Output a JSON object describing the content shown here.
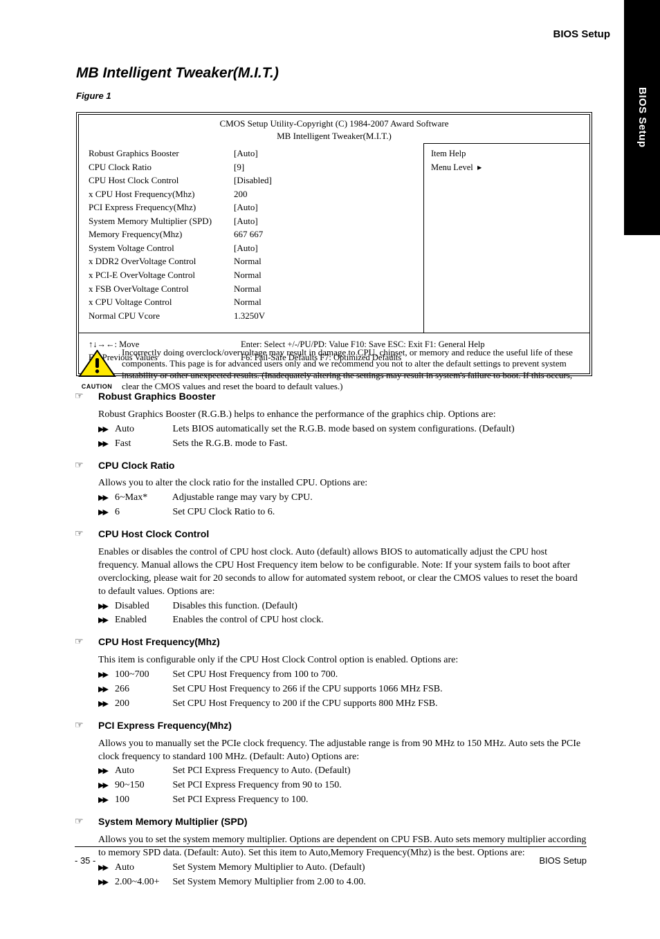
{
  "sideTab": "BIOS Setup",
  "breadcrumb": "BIOS Setup",
  "sectionTitle": "MB Intelligent Tweaker(M.I.T.)",
  "figCaption": "Figure 1",
  "bios": {
    "title": "CMOS Setup Utility-Copyright (C) 1984-2007 Award Software",
    "subtitle": "MB Intelligent Tweaker(M.I.T.)",
    "rows": [
      {
        "label": "Robust Graphics Booster",
        "value": "[Auto]"
      },
      {
        "label": "CPU Clock Ratio",
        "value": "[9]"
      },
      {
        "label": "CPU Host Clock Control",
        "value": "[Disabled]"
      },
      {
        "label": "x CPU Host Frequency(Mhz)",
        "value": "200"
      },
      {
        "label": "PCI Express Frequency(Mhz)",
        "value": "[Auto]"
      },
      {
        "label": "System Memory Multiplier (SPD)",
        "value": "[Auto]"
      },
      {
        "label": "Memory Frequency(Mhz)",
        "value": "667   667"
      },
      {
        "label": "System Voltage Control",
        "value": "[Auto]"
      },
      {
        "label": "x DDR2 OverVoltage Control",
        "value": "Normal"
      },
      {
        "label": "x PCI-E OverVoltage Control",
        "value": "Normal"
      },
      {
        "label": "x FSB OverVoltage Control",
        "value": "Normal"
      },
      {
        "label": "x CPU Voltage Control",
        "value": "Normal"
      },
      {
        "label": "Normal CPU Vcore",
        "value": "1.3250V"
      }
    ],
    "help": {
      "head": "Item Help",
      "menuLevel": "Menu Level"
    },
    "footer": [
      {
        "left": "↑↓→←: Move",
        "right": "Enter: Select   +/-/PU/PD: Value   F10: Save   ESC: Exit   F1: General Help"
      },
      {
        "left": "F5: Previous Values",
        "right": "F6: Fail-Safe Defaults   F7: Optimized Defaults"
      }
    ]
  },
  "caution": "Incorrectly doing overclock/overvoltage may result in damage to CPU, chipset, or memory and reduce the useful life of these components. This page is for advanced users only and we recommend you not to alter the default settings to prevent system instability or other unexpected results. (Inadequately altering the settings may result in system's failure to boot. If this occurs, clear the CMOS values and reset the board to default values.)",
  "items": [
    {
      "name": "Robust Graphics Booster",
      "desc": "Robust Graphics Booster (R.G.B.) helps to enhance the performance of the graphics chip. Options are:",
      "opts": [
        {
          "label": "Auto",
          "text": "Lets BIOS automatically set the R.G.B. mode based on system configurations. (Default)"
        },
        {
          "label": "Fast",
          "text": "Sets the R.G.B. mode to Fast."
        }
      ]
    },
    {
      "name": "CPU Clock Ratio",
      "desc": "Allows you to alter the clock ratio for the installed CPU. Options are:",
      "opts": [
        {
          "label": "6~Max*",
          "text": "Adjustable range may vary by CPU."
        },
        {
          "label": "6",
          "text": "Set CPU Clock Ratio to 6."
        }
      ]
    },
    {
      "name": "CPU Host Clock Control",
      "desc": "Enables or disables the control of CPU host clock. Auto (default) allows BIOS to automatically adjust the CPU host frequency. Manual allows the CPU Host Frequency item below to be configurable. Note: If your system fails to boot after overclocking, please wait for 20 seconds to allow for automated system reboot, or clear the CMOS values to reset the board to default values. Options are:",
      "opts": [
        {
          "label": "Disabled",
          "text": "Disables this function.  (Default)"
        },
        {
          "label": "Enabled",
          "text": "Enables the control of CPU host clock."
        }
      ]
    },
    {
      "name": "CPU Host Frequency(Mhz)",
      "desc": "This item is configurable only if the CPU Host Clock Control option is enabled. Options are:",
      "opts": [
        {
          "label": "100~700",
          "text": "Set CPU Host Frequency from 100 to 700."
        },
        {
          "label": "266",
          "text": "Set CPU Host Frequency to 266 if the CPU supports 1066 MHz FSB."
        },
        {
          "label": "200",
          "text": "Set CPU Host Frequency to 200 if the CPU supports 800 MHz FSB."
        }
      ]
    },
    {
      "name": "PCI Express Frequency(Mhz)",
      "desc": "Allows you to manually set the PCIe clock frequency. The adjustable range is from 90 MHz to 150 MHz. Auto sets the PCIe clock frequency to standard 100 MHz. (Default: Auto) Options are:",
      "opts": [
        {
          "label": "Auto",
          "text": "Set PCI Express Frequency to Auto. (Default)"
        },
        {
          "label": "90~150",
          "text": "Set PCI Express Frequency from 90 to 150."
        },
        {
          "label": "100",
          "text": "Set PCI Express Frequency to 100."
        }
      ]
    },
    {
      "name": "System Memory Multiplier (SPD)",
      "desc": "Allows you to set the system memory multiplier. Options are dependent on CPU FSB. Auto sets memory multiplier according to memory SPD data. (Default: Auto). Set this item to Auto,Memory Frequency(Mhz) is the best. Options are:",
      "opts": [
        {
          "label": "Auto",
          "text": "Set System Memory Multiplier to Auto. (Default)"
        },
        {
          "label": "2.00~4.00+",
          "text": "Set System Memory Multiplier from 2.00 to 4.00."
        }
      ]
    }
  ],
  "pageNum": "- 35 -",
  "footerLabel": "BIOS Setup"
}
